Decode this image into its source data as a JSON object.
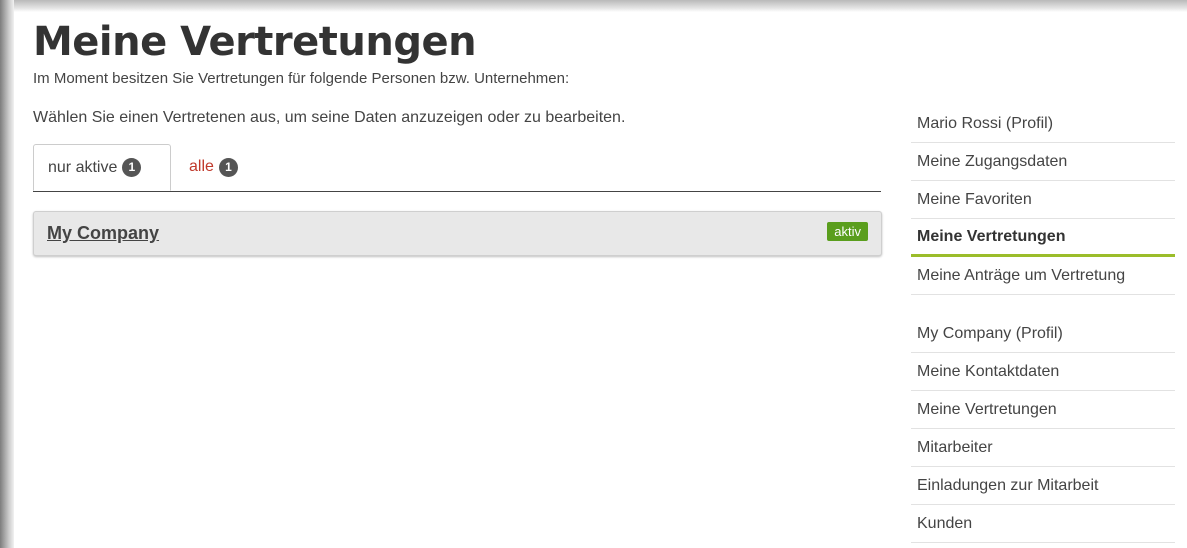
{
  "header": {
    "title": "Meine Vertretungen",
    "subtitle": "Im Moment besitzen Sie Vertretungen für folgende Personen bzw. Unternehmen:",
    "instruction": "Wählen Sie einen Vertretenen aus, um seine Daten anzuzeigen oder zu bearbeiten."
  },
  "tabs": [
    {
      "label": "nur aktive",
      "count": "1",
      "active": true
    },
    {
      "label": "alle",
      "count": "1",
      "active": false
    }
  ],
  "entries": [
    {
      "name": "My Company",
      "status": "aktiv"
    }
  ],
  "sidebar": {
    "personal": [
      {
        "label": "Mario Rossi (Profil)"
      },
      {
        "label": "Meine Zugangsdaten"
      },
      {
        "label": "Meine Favoriten"
      },
      {
        "label": "Meine Vertretungen",
        "active": true
      },
      {
        "label": "Meine Anträge um Vertretung"
      }
    ],
    "company": [
      {
        "label": "My Company (Profil)"
      },
      {
        "label": "Meine Kontaktdaten"
      },
      {
        "label": "Meine Vertretungen"
      },
      {
        "label": "Mitarbeiter"
      },
      {
        "label": "Einladungen zur Mitarbeit"
      },
      {
        "label": "Kunden"
      }
    ]
  },
  "colors": {
    "accent": "#9bbd2a",
    "status_active": "#5a9e1d",
    "link_red": "#c0392b"
  }
}
